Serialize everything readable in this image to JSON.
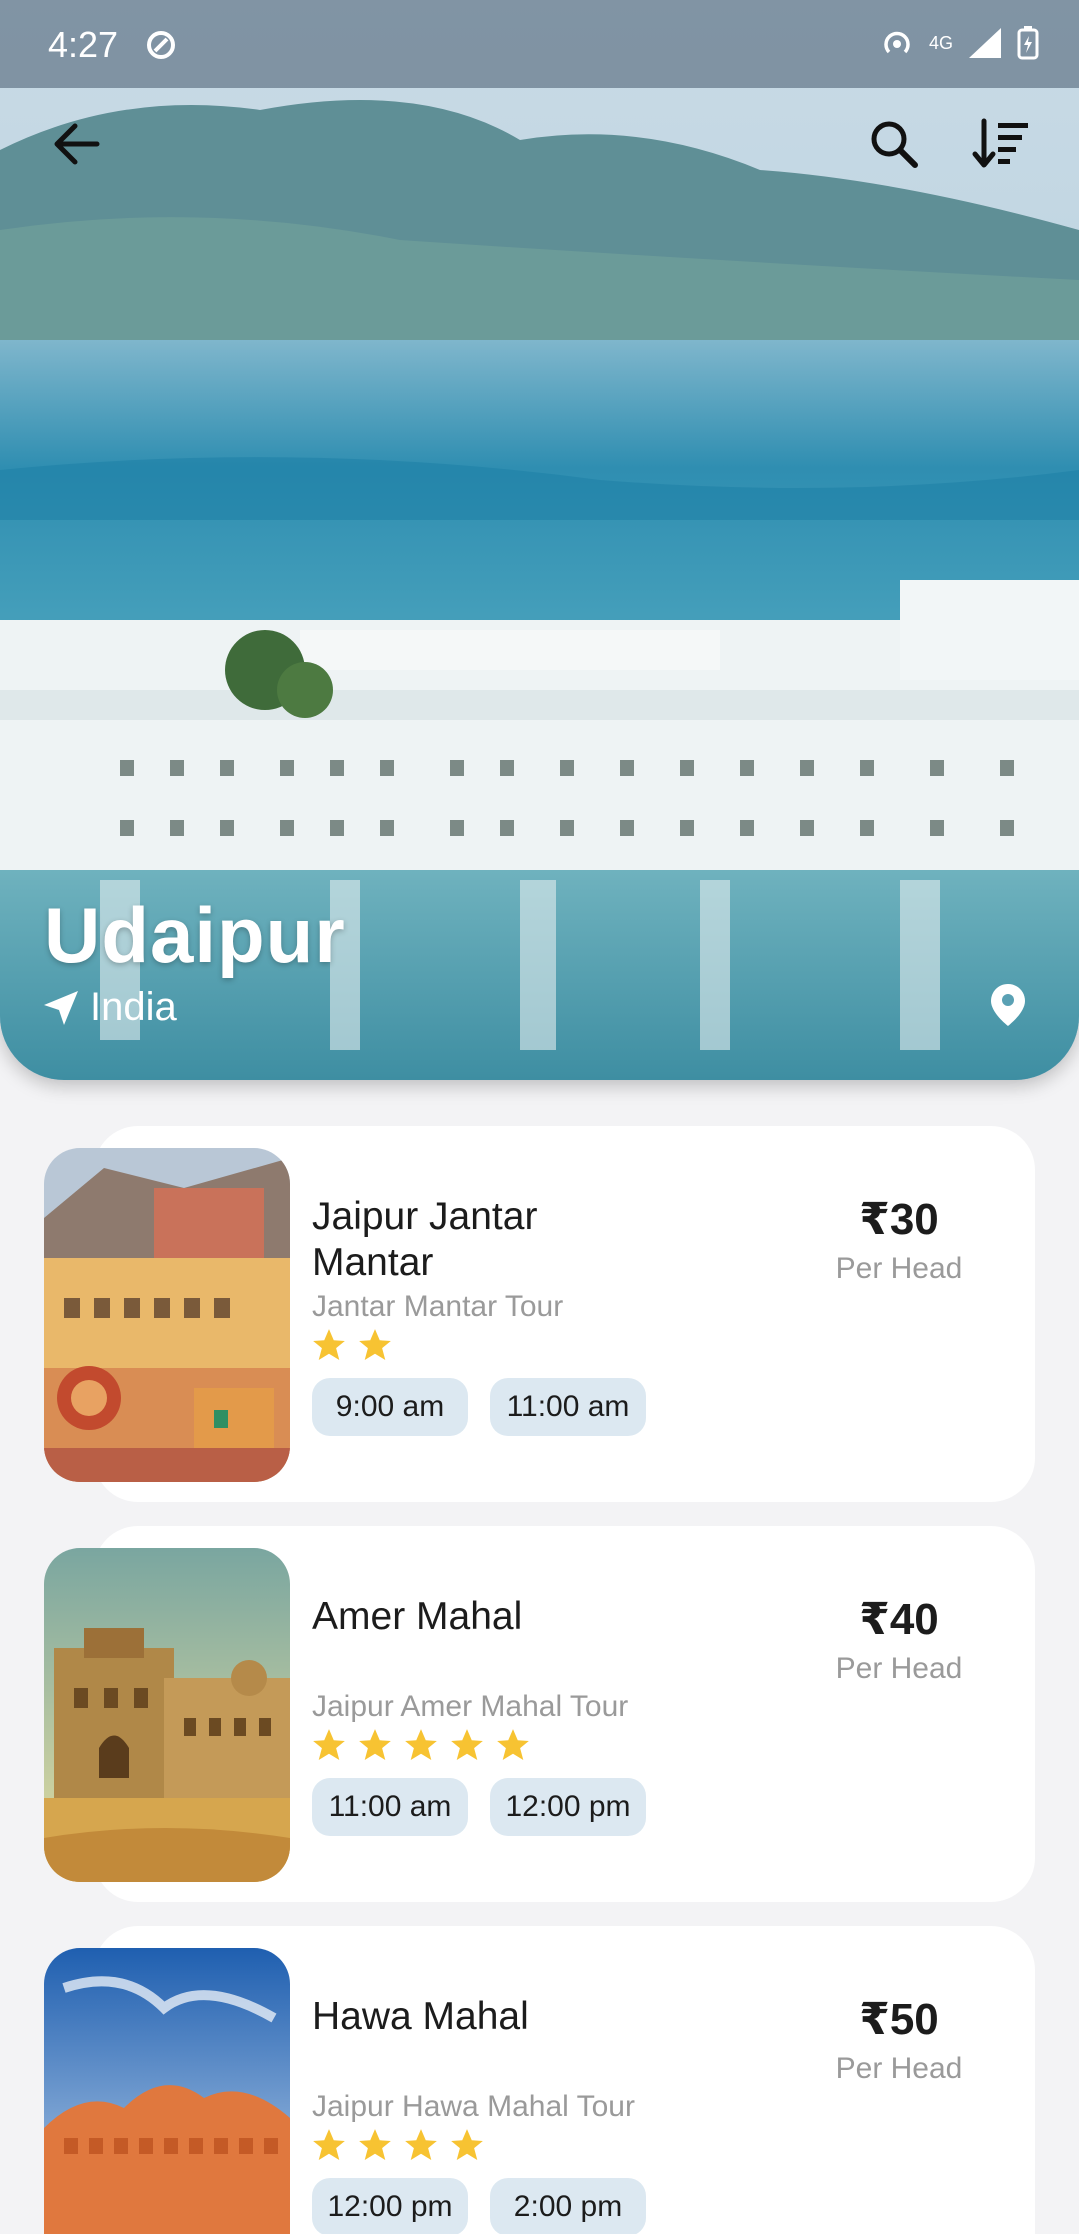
{
  "status": {
    "time": "4:27",
    "network": "4G"
  },
  "hero": {
    "city": "Udaipur",
    "country": "India"
  },
  "colors": {
    "star": "#f7c332",
    "pill": "#dce8f1",
    "muted": "#9a9a9a"
  },
  "tours": [
    {
      "title": "Jaipur Jantar Mantar",
      "subtitle": "Jantar Mantar Tour",
      "rating": 2,
      "times": [
        "9:00 am",
        "11:00 am"
      ],
      "price": "₹30",
      "price_unit": "Per Head"
    },
    {
      "title": "Amer Mahal",
      "subtitle": "Jaipur Amer Mahal Tour",
      "rating": 5,
      "times": [
        "11:00 am",
        "12:00 pm"
      ],
      "price": "₹40",
      "price_unit": "Per Head"
    },
    {
      "title": "Hawa Mahal",
      "subtitle": "Jaipur Hawa Mahal Tour",
      "rating": 4,
      "times": [
        "12:00 pm",
        "2:00 pm"
      ],
      "price": "₹50",
      "price_unit": "Per Head"
    }
  ],
  "icons": {
    "back": "arrow-left-icon",
    "search": "search-icon",
    "sort": "sort-icon",
    "navigate": "navigation-arrow-icon",
    "location": "location-pin-icon"
  }
}
